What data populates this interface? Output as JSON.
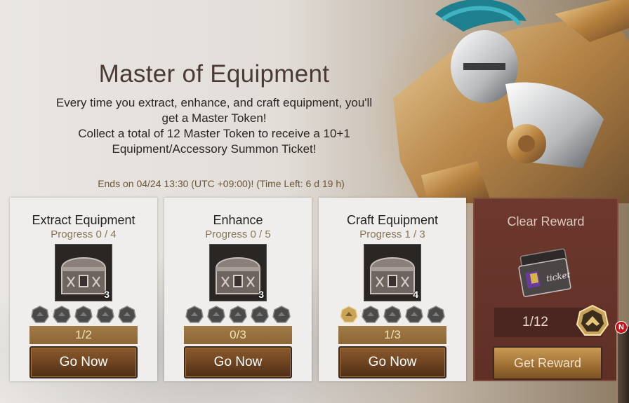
{
  "event": {
    "title": "Master of Equipment",
    "description_lines": [
      "Every time you extract, enhance, and craft equipment, you'll",
      "get a Master Token!",
      "Collect a total of 12 Master Token to receive a 10+1",
      "Equipment/Accessory Summon Ticket!"
    ],
    "ends_text": "Ends on 04/24 13:30 (UTC +09:00)! (Time Left: 6 d 19 h)"
  },
  "missions": [
    {
      "title": "Extract Equipment",
      "progress_text": "Progress 0 / 4",
      "reward_count": "3",
      "tokens_filled": 0,
      "tokens_total": 5,
      "count_text": "1/2",
      "button_label": "Go Now"
    },
    {
      "title": "Enhance",
      "progress_text": "Progress 0 / 5",
      "reward_count": "3",
      "tokens_filled": 0,
      "tokens_total": 5,
      "count_text": "0/3",
      "button_label": "Go Now"
    },
    {
      "title": "Craft Equipment",
      "progress_text": "Progress 1 / 3",
      "reward_count": "4",
      "tokens_filled": 1,
      "tokens_total": 5,
      "count_text": "1/3",
      "button_label": "Go Now"
    }
  ],
  "clear_reward": {
    "title": "Clear Reward",
    "count_text": "1/12",
    "ticket_label": "ticket",
    "button_label": "Get Reward"
  },
  "side_tab": {
    "badge": "N"
  },
  "icons": {
    "chest": "treasure-chest-icon",
    "token": "master-token-icon",
    "ticket": "summon-ticket-icon"
  },
  "colors": {
    "card_bg": "#efeeec",
    "reward_card_bg": "#6d382e",
    "button_brown": "#6c4220",
    "token_gold": "#c9a35a",
    "token_gray": "#4a4a4a"
  }
}
